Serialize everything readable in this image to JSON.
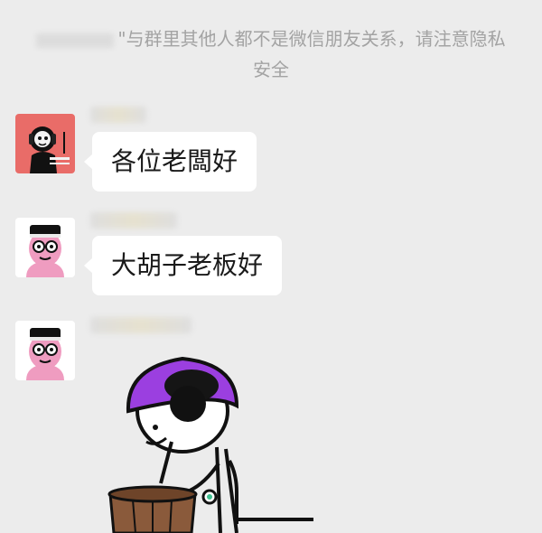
{
  "system_notice": {
    "name_placeholder": "\"",
    "text": "\"与群里其他人都不是微信朋友关系，请注意隐私安全"
  },
  "messages": [
    {
      "text": "各位老闆好",
      "avatar": "cartoon-headphones-avatar"
    },
    {
      "text": "大胡子老板好",
      "avatar": "cartoon-glasses-avatar"
    },
    {
      "text": "",
      "avatar": "cartoon-glasses-avatar",
      "sticker": "cartoon-purple-hat-drinking-sticker"
    }
  ]
}
